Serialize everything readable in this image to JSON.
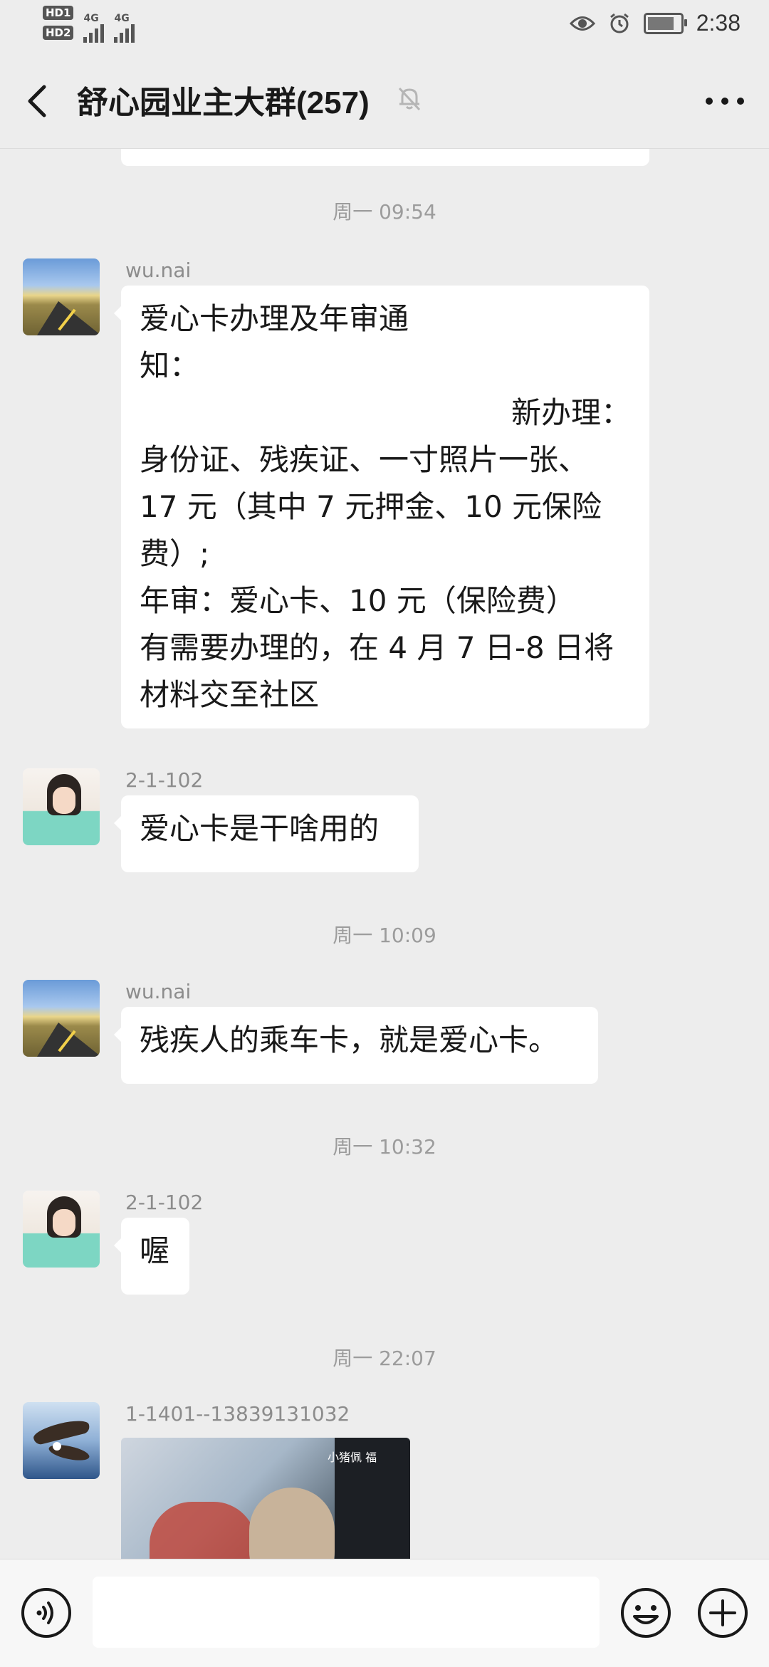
{
  "status_bar": {
    "time": "2:38",
    "sim_badges": [
      "HD1",
      "HD2"
    ],
    "network": [
      "4G",
      "4G"
    ]
  },
  "header": {
    "title": "舒心园业主大群(257)",
    "back_icon": "chevron-left-icon",
    "mute_icon": "bell-off-icon",
    "more_icon": "ellipsis-icon"
  },
  "messages": [
    {
      "type": "time",
      "text": "周一 09:54"
    },
    {
      "type": "text",
      "sender": "wu.nai",
      "lines": [
        "爱心卡办理及年审通",
        "知：",
        "新办理：",
        "身份证、残疾证、一寸照片一张、",
        "17 元（其中 7 元押金、10 元保险",
        "费）;",
        "年审：爱心卡、10 元（保险费）",
        "有需要办理的，在 4 月 7 日-8 日将",
        "材料交至社区"
      ]
    },
    {
      "type": "text",
      "sender": "2-1-102",
      "lines": [
        "爱心卡是干啥用的"
      ]
    },
    {
      "type": "time",
      "text": "周一 10:09"
    },
    {
      "type": "text",
      "sender": "wu.nai",
      "lines": [
        "残疾人的乘车卡，就是爱心卡。"
      ]
    },
    {
      "type": "time",
      "text": "周一 10:32"
    },
    {
      "type": "text",
      "sender": "2-1-102",
      "lines": [
        "喔"
      ]
    },
    {
      "type": "time",
      "text": "周一 22:07"
    },
    {
      "type": "image",
      "sender": "1-1401--13839131032",
      "caption": "小猪佩 福"
    }
  ],
  "input_bar": {
    "placeholder": "",
    "voice_icon": "voice-icon",
    "emoji_icon": "emoji-icon",
    "plus_icon": "plus-icon"
  },
  "colors": {
    "background": "#ededed",
    "bubble": "#ffffff",
    "timestamp": "#9c9c9c",
    "nickname": "#8c8c8c"
  }
}
